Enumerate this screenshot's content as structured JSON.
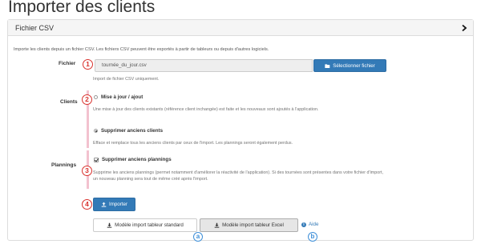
{
  "page": {
    "title": "Importer des clients"
  },
  "panel": {
    "title": "Fichier CSV",
    "intro": "Importe les clients depuis un fichier CSV. Les fichiers CSV peuvent être exportés à partir de tableurs ou depuis d'autres logiciels."
  },
  "file": {
    "label": "Fichier",
    "value": "tournée_du_jour.csv",
    "select_button": "Sélectionner fichier",
    "help": "Import de fichier CSV uniquement."
  },
  "clients": {
    "label": "Clients",
    "option_update": "Mise à jour / ajout",
    "option_update_help": "Une mise à jour des clients existants (référence client inchangée) est faite et les nouveaux sont ajoutés à l'application.",
    "option_replace": "Supprimer anciens clients",
    "option_replace_help": "Efface et remplace tous les anciens clients par ceux de l'import. Les plannings seront également perdus.",
    "selected": "replace"
  },
  "plannings": {
    "label": "Plannings",
    "option_delete": "Supprimer anciens plannings",
    "option_delete_help": "Supprime les anciens plannings (permet notamment d'améliorer la réactivité de l'application). Si des tournées sont présentes dans votre fichier d'import, un nouveau planning sera tout de même créé après l'import.",
    "checked": true
  },
  "actions": {
    "import_button": "Importer",
    "template_standard": "Modèle import tableur standard",
    "template_excel": "Modèle import tableur Excel",
    "help_link": "Aide"
  },
  "annotations": {
    "badge_1": "1",
    "badge_2": "2",
    "badge_3": "3",
    "badge_4": "4",
    "badge_a": "a",
    "badge_b": "b"
  },
  "colors": {
    "primary": "#337ab7",
    "annotation_red": "#d9322e",
    "annotation_blue": "#3e8fd8",
    "highlight_pink": "#f3c2cf"
  },
  "icons": {
    "panel_toggle": "chevron-right-icon",
    "select_file": "folder-open-icon",
    "import": "upload-icon",
    "template_download": "download-icon",
    "help": "info-circle-icon"
  }
}
